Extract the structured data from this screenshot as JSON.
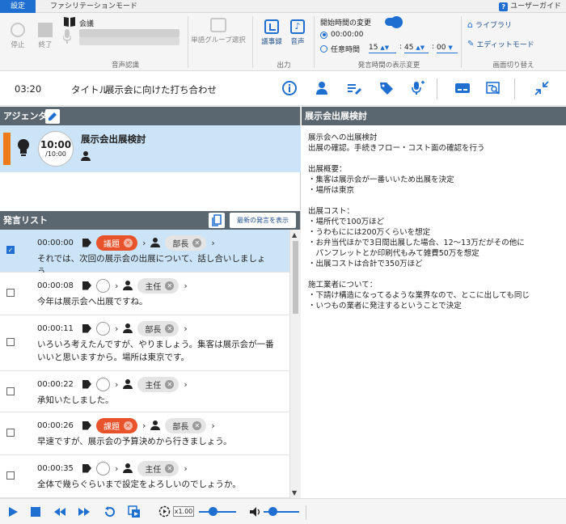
{
  "tabs": {
    "settings": "設定",
    "facilitation": "ファシリテーションモード"
  },
  "guide": "ユーザーガイド",
  "ribbon": {
    "stop": "停止",
    "end": "終了",
    "meeting_label": "会議",
    "recognition_group": "音声認識",
    "word_group_select": "単語グループ選択",
    "minutes": "議事録",
    "audio": "音声",
    "output_group": "出力",
    "start_time_change": "開始時間の変更",
    "start_time_default": "00:00:00",
    "arbitrary_time": "任意時間",
    "time_hh": "15",
    "time_mm": "45",
    "time_ss": "00",
    "time_colon": ":",
    "display_group": "発言時間の表示変更",
    "library": "ライブラリ",
    "edit_mode": "エディットモード",
    "screen_group": "画面切り替え"
  },
  "infobar": {
    "elapsed": "03:20",
    "title_label": "タイトル",
    "title_value": "展示会に向けた打ち合わせ"
  },
  "agenda": {
    "header": "アジェンダ",
    "item": {
      "clock_main": "10:00",
      "clock_sub": "/10:00",
      "title": "展示会出展検討"
    }
  },
  "notes": {
    "header": "展示会出展検討",
    "body": "展示会への出展検討\n出展の確認。手続きフロー・コスト面の確認を行う\n\n出展概要：\n・集客は展示会が一番いいため出展を決定\n・場所は東京\n\n出展コスト：\n・場所代で100万ほど\n・うわもにには200万くらいを想定\n・お弁当代ほかで3日間出展した場合、12～13万だがその他に\n　パンフレットとか印刷代もみて雑費50万を想定\n・出展コストは合計で350万ほど\n\n施工業者について：\n・下請け構造になってるような業界なので、とこに出しても同じ\n・いつもの業者に発注するということで決定"
  },
  "speech": {
    "header": "発言リスト",
    "latest_button": "最新の発言を表示",
    "rows": [
      {
        "time": "00:00:00",
        "tag": "議題",
        "role": "部長",
        "text": "それでは、次回の展示会の出展について、話し合いしましょう。"
      },
      {
        "time": "00:00:08",
        "tag": "",
        "role": "主任",
        "text": "今年は展示会へ出展ですね。"
      },
      {
        "time": "00:00:11",
        "tag": "",
        "role": "部長",
        "text": "いろいろ考えたんですが、やりましょう。集客は展示会が一番いいと思いますから。場所は東京です。"
      },
      {
        "time": "00:00:22",
        "tag": "",
        "role": "主任",
        "text": "承知いたしました。"
      },
      {
        "time": "00:00:26",
        "tag": "課題",
        "role": "部長",
        "text": "早速ですが、展示会の予算決めから行きましょう。"
      },
      {
        "time": "00:00:35",
        "tag": "",
        "role": "主任",
        "text": "全体で幾らぐらいまで設定をよろしいのでしょうか。"
      }
    ]
  },
  "player": {
    "speed": "x1.00"
  },
  "colors": {
    "accent": "#1f6fd1",
    "header": "#5b6770",
    "selected": "#cce4f7",
    "tag_red": "#e8532b",
    "agenda_orange": "#ee7b1b"
  }
}
